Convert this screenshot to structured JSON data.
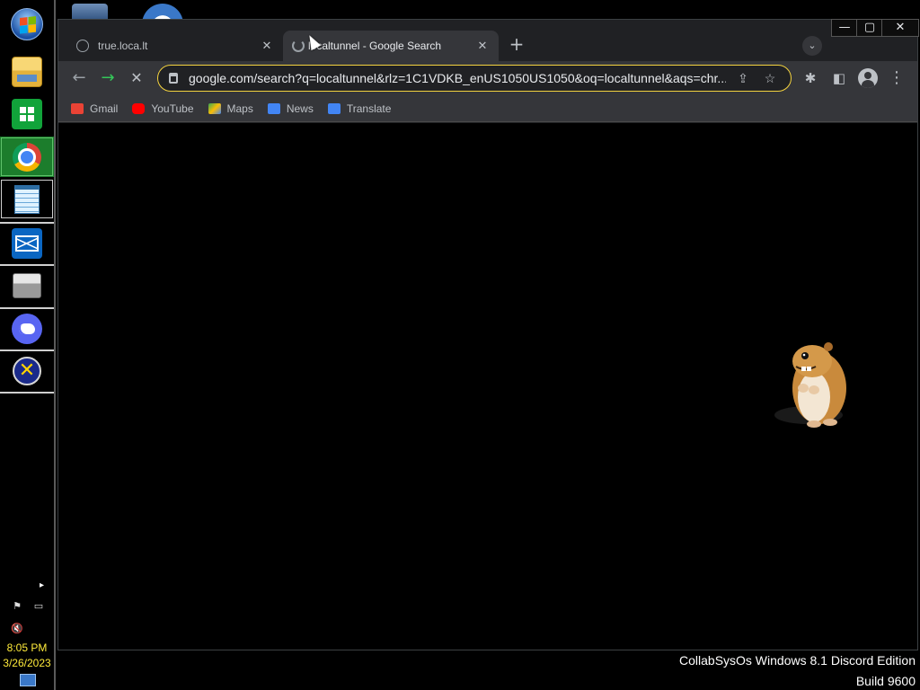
{
  "os": {
    "watermark_line1": "CollabSysOs Windows 8.1 Discord Edition",
    "watermark_line2": "Build 9600",
    "clock_time": "8:05 PM",
    "clock_date": "3/26/2023"
  },
  "taskbar": {
    "apps": [
      {
        "name": "start-orb-icon"
      },
      {
        "name": "file-explorer-icon"
      },
      {
        "name": "store-icon"
      },
      {
        "name": "chrome-icon"
      },
      {
        "name": "notepad-icon"
      },
      {
        "name": "mail-icon"
      },
      {
        "name": "printer-icon"
      },
      {
        "name": "discord-icon"
      },
      {
        "name": "xfire-icon"
      }
    ],
    "tray_chevron": "▸",
    "tray_icons": [
      "flag-icon",
      "network-icon",
      "volume-muted-icon"
    ]
  },
  "browser": {
    "tabs": [
      {
        "title": "true.loca.lt",
        "active": false,
        "close": "✕"
      },
      {
        "title": "localtunnel - Google Search",
        "active": true,
        "close": "✕"
      }
    ],
    "new_tab": "+",
    "tab_search": "⌄",
    "window_buttons": {
      "minimize": "—",
      "maximize": "▢",
      "close": "✕"
    },
    "toolbar": {
      "back": "←",
      "forward": "→",
      "stop": "✕",
      "url": "google.com/search?q=localtunnel&rlz=1C1VDKB_enUS1050US1050&oq=localtunnel&aqs=chr...",
      "share": "⇪",
      "bookmark": "☆",
      "extensions": "✱",
      "side_panel": "◧",
      "menu": "⋮"
    },
    "bookmarks": [
      {
        "label": "Gmail",
        "color": "#ea4335"
      },
      {
        "label": "YouTube",
        "color": "#ff0000"
      },
      {
        "label": "Maps",
        "color": "#34a853"
      },
      {
        "label": "News",
        "color": "#4285f4"
      },
      {
        "label": "Translate",
        "color": "#4285f4"
      }
    ]
  },
  "colors": {
    "omnibox_border": "#f4d33f",
    "forward_arrow": "#34c759",
    "clock_text": "#ffeb3b"
  }
}
